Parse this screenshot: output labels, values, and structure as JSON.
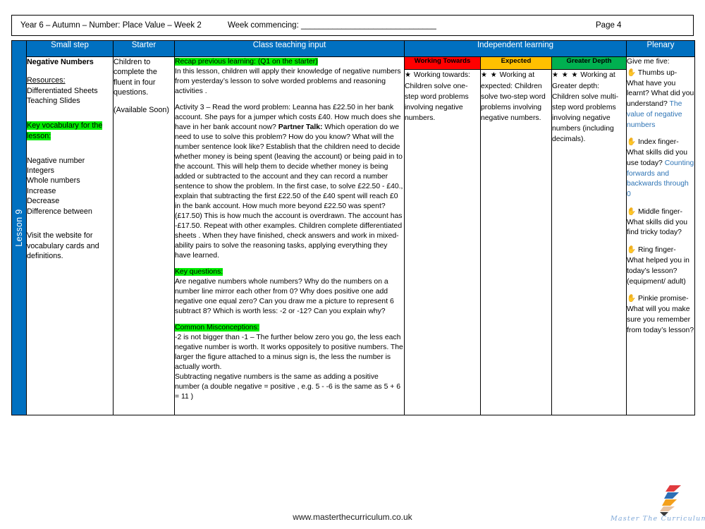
{
  "header": {
    "title": "Year 6 – Autumn – Number: Place Value – Week 2",
    "week_commencing": "Week commencing: ______________________________",
    "page": "Page 4"
  },
  "spine": {
    "label": "Lesson 9"
  },
  "columns": {
    "small_step": "Small step",
    "starter": "Starter",
    "class_teaching_input": "Class teaching input",
    "independent_learning": "Independent learning",
    "plenary": "Plenary"
  },
  "small_step": {
    "title": "Negative Numbers",
    "resources_label": "Resources:",
    "resources": [
      "Differentiated Sheets",
      "Teaching Slides"
    ],
    "key_vocab_heading": "Key vocabulary for the lesson:",
    "vocab": [
      "Negative number",
      "Integers",
      "Whole numbers",
      "Increase",
      "Decrease",
      "Difference between"
    ],
    "footnote": "Visit the website for vocabulary cards and definitions."
  },
  "starter": {
    "line1": "Children to complete the fluent in four questions.",
    "line2": "(Available Soon)"
  },
  "teaching_input": {
    "recap_heading": "Recap previous learning: (Q1 on the starter)",
    "recap_body": "In this lesson, children will apply their knowledge of negative numbers from yesterday’s lesson to solve worded problems and reasoning activities .",
    "activity_pre": "Activity 3 – Read the word problem: Leanna has £22.50 in her bank account. She pays for a jumper which costs £40. How much does she have in her bank account now? ",
    "activity_bold": "Partner Talk:",
    "activity_post": " Which operation do we need to use to solve this problem? How do you know? What will the number sentence look like? Establish that the children need to decide whether money is being spent (leaving the  account) or being paid in to the account. This will help them to decide whether money is being added or subtracted to the account and they can record a number sentence to show the problem. In the first case, to solve £22.50 - £40., explain that subtracting the first £22.50  of the £40 spent will reach £0 in the bank account. How much more beyond £22.50 was spent? (£17.50) This is how much the account is overdrawn. The account has -£17.50.  Repeat with other examples. Children complete differentiated sheets . When they have finished, check answers and work in mixed-ability pairs to solve the reasoning tasks, applying everything they have learned.",
    "key_questions_heading": "Key questions:",
    "key_questions_body": "Are negative numbers whole numbers? Why do the numbers on a number line mirror each other from 0? Why does positive one add negative one equal zero? Can you draw me a picture to represent 6 subtract 8? Which is  worth less: -2 or -12? Can you explain why?",
    "misconceptions_heading": "Common Misconceptions:",
    "misconceptions_body_1": "-2 is not bigger than -1 – The further below zero you go, the less each negative number is worth.  It works oppositely to positive numbers. The larger the  figure attached to a minus sign is, the less the number  is actually worth.",
    "misconceptions_body_2": "Subtracting negative numbers is the same as adding a positive number (a double negative =  positive , e.g. 5 - -6 is the same as 5 + 6 = 11 )"
  },
  "independent_learning": [
    {
      "header": "Working Towards",
      "header_color": "#FF0000",
      "stars": "★",
      "lead": "Working towards:",
      "body": "Children solve one-step word problems involving negative numbers."
    },
    {
      "header": "Expected",
      "header_color": "#FFC000",
      "stars": "★ ★",
      "lead": "Working at expected:",
      "body": "Children solve two-step word problems involving negative numbers."
    },
    {
      "header": "Greater Depth",
      "header_color": "#00B050",
      "stars": "★ ★ ★",
      "lead": "Working at Greater depth:",
      "body": "Children solve multi-step word problems involving negative numbers (including decimals)."
    }
  ],
  "plenary": {
    "intro": "Give me five:",
    "items": [
      {
        "icon": "hand-icon",
        "black": "Thumbs up- What have you learnt? What did you understand?",
        "blue": "The value of negative numbers"
      },
      {
        "icon": "hand-icon",
        "black": "Index finger- What skills did you use today?",
        "blue": "Counting forwards and backwards through 0"
      },
      {
        "icon": "hand-icon",
        "black": "Middle finger- What skills did you find tricky today?",
        "blue": ""
      },
      {
        "icon": "hand-icon",
        "black": "Ring finger- What helped you in today’s lesson? (equipment/ adult)",
        "blue": ""
      },
      {
        "icon": "hand-icon",
        "black": "Pinkie promise- What will you make sure you remember from today’s lesson?",
        "blue": ""
      }
    ]
  },
  "footer": {
    "url": "www.masterthecurriculum.co.uk",
    "logo_words": "Master  The  Curriculum"
  },
  "colors": {
    "header_blue": "#0070C0",
    "highlight_green": "#00EE00",
    "working_towards": "#FF0000",
    "expected": "#FFC000",
    "greater_depth": "#00B050",
    "plenary_blue_text": "#2E74B5"
  }
}
